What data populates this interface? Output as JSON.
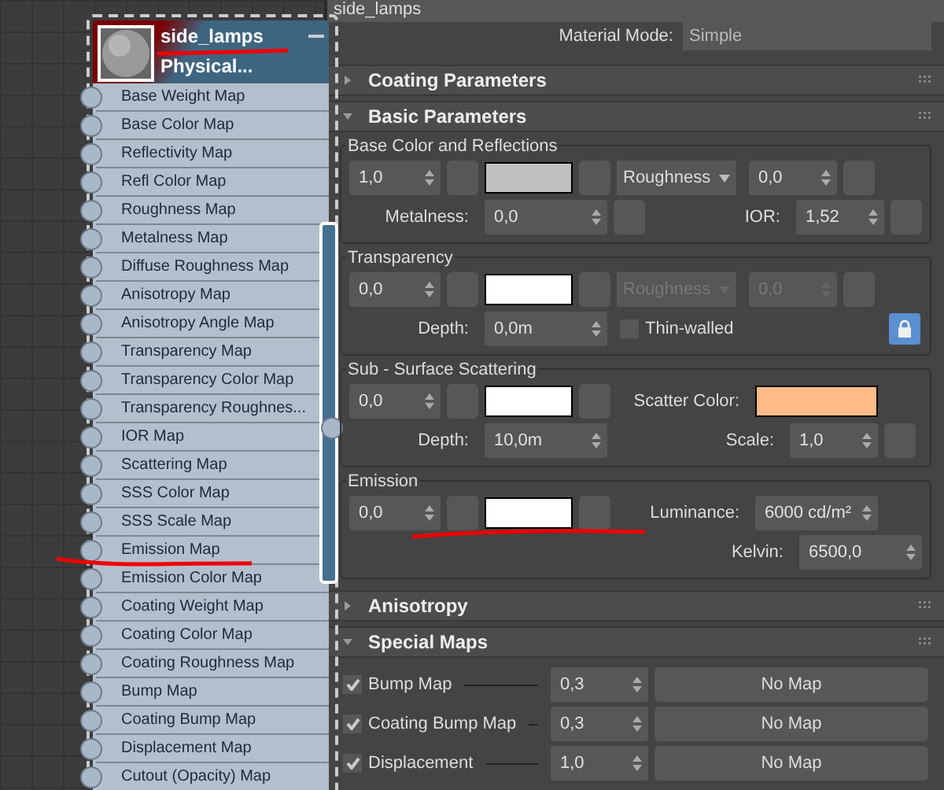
{
  "node": {
    "title": "side_lamps",
    "subtitle": "Physical...",
    "selected": true,
    "slots": [
      "Base Weight Map",
      "Base Color Map",
      "Reflectivity Map",
      "Refl Color Map",
      "Roughness Map",
      "Metalness Map",
      "Diffuse Roughness Map",
      "Anisotropy Map",
      "Anisotropy Angle Map",
      "Transparency Map",
      "Transparency Color Map",
      "Transparency Roughnes...",
      "IOR Map",
      "Scattering Map",
      "SSS Color Map",
      "SSS Scale Map",
      "Emission Map",
      "Emission Color Map",
      "Coating Weight Map",
      "Coating Color Map",
      "Coating Roughness Map",
      "Bump Map",
      "Coating Bump Map",
      "Displacement Map",
      "Cutout (Opacity) Map"
    ]
  },
  "panel": {
    "name_field": "side_lamps",
    "material_mode": {
      "label": "Material Mode:",
      "value": "Simple"
    },
    "rollouts": [
      {
        "kind": "collapsed",
        "title": "Coating Parameters",
        "expanded": false
      },
      {
        "kind": "basic",
        "title": "Basic Parameters",
        "expanded": true,
        "base": {
          "title": "Base Color and Reflections",
          "weight": "1,0",
          "color": "#c0c0c0",
          "roughness_mode": {
            "value": "Roughness",
            "disabled": false
          },
          "roughness": {
            "value": "0,0",
            "disabled": false
          },
          "metalness": {
            "label": "Metalness:",
            "value": "0,0"
          },
          "ior": {
            "label": "IOR:",
            "value": "1,52"
          }
        },
        "transparency": {
          "title": "Transparency",
          "weight": "0,0",
          "color": "#ffffff",
          "roughness_mode": {
            "value": "Roughness",
            "disabled": true
          },
          "roughness": {
            "value": "0,0",
            "disabled": true
          },
          "depth": {
            "label": "Depth:",
            "value": "0,0m"
          },
          "thin_walled": {
            "label": "Thin-walled",
            "checked": false
          },
          "lock": {
            "on": true
          }
        },
        "sss": {
          "title": "Sub - Surface Scattering",
          "weight": "0,0",
          "color": "#ffffff",
          "scatter_color": {
            "label": "Scatter Color:",
            "color": "#ffbb88"
          },
          "depth": {
            "label": "Depth:",
            "value": "10,0m"
          },
          "scale": {
            "label": "Scale:",
            "value": "1,0"
          }
        },
        "emission": {
          "title": "Emission",
          "weight": "0,0",
          "color": "#ffffff",
          "luminance": {
            "label": "Luminance:",
            "value": "6000 cd/m²"
          },
          "kelvin": {
            "label": "Kelvin:",
            "value": "6500,0"
          }
        }
      },
      {
        "kind": "collapsed",
        "title": "Anisotropy",
        "expanded": false
      },
      {
        "kind": "maps",
        "title": "Special Maps",
        "expanded": true,
        "rows": [
          {
            "label": "Bump Map",
            "checked": true,
            "value": "0,3",
            "map": "No Map"
          },
          {
            "label": "Coating Bump Map",
            "checked": true,
            "value": "0,3",
            "map": "No Map"
          },
          {
            "label": "Displacement",
            "checked": true,
            "value": "1,0",
            "map": "No Map"
          }
        ]
      }
    ]
  }
}
